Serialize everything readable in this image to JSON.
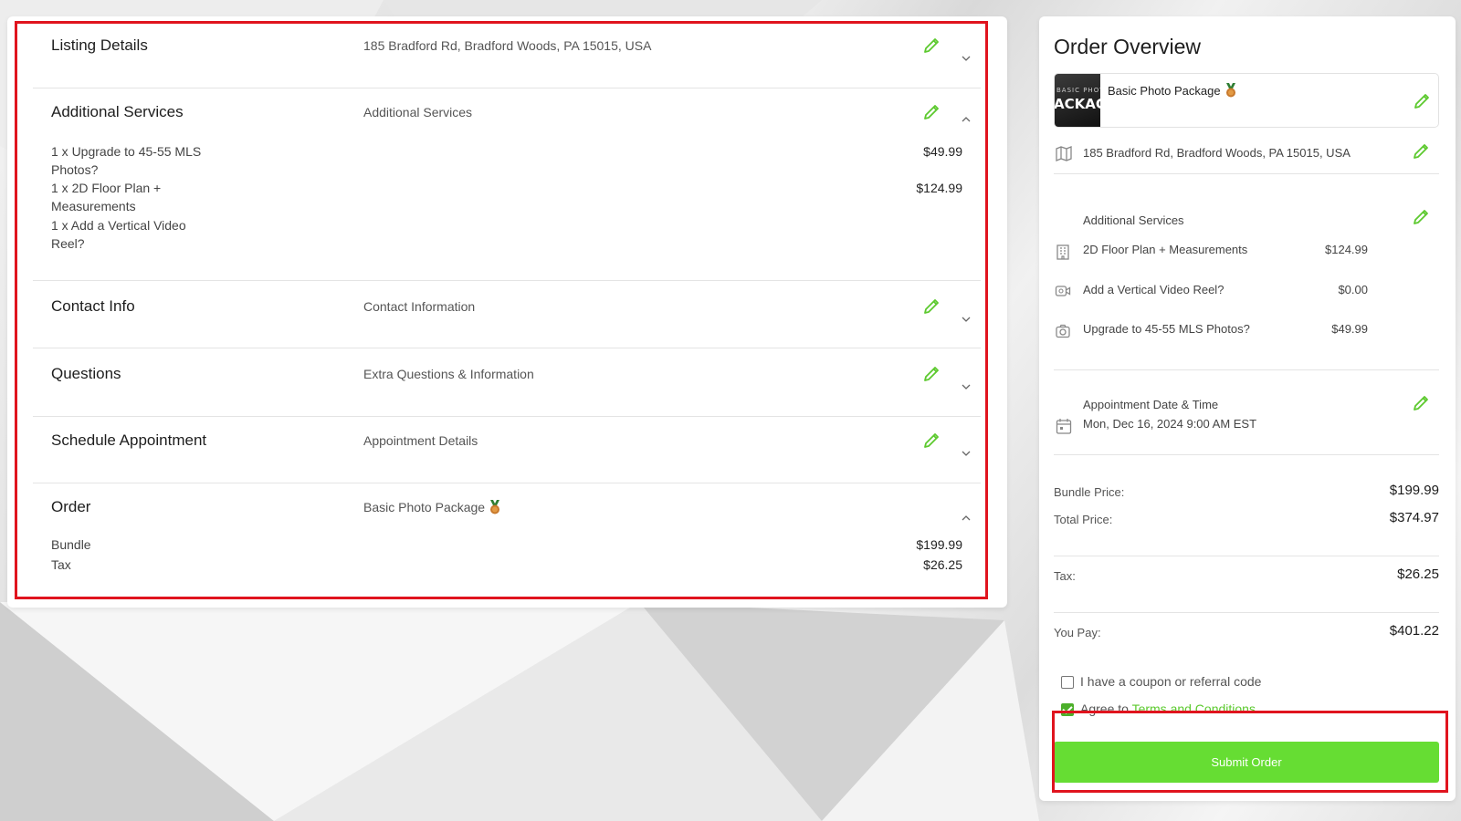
{
  "left": {
    "sections": [
      {
        "title": "Listing Details",
        "subtitle": "185 Bradford Rd, Bradford Woods, PA 15015, USA",
        "expanded": false
      },
      {
        "title": "Additional Services",
        "subtitle": "Additional Services",
        "expanded": true,
        "items": [
          {
            "label": "1 x Upgrade to 45-55 MLS Photos?",
            "price": "$49.99"
          },
          {
            "label": "1 x 2D Floor Plan + Measurements",
            "price": "$124.99"
          },
          {
            "label": "1 x Add a Vertical Video Reel?",
            "price": ""
          }
        ]
      },
      {
        "title": "Contact Info",
        "subtitle": "Contact Information",
        "expanded": false
      },
      {
        "title": "Questions",
        "subtitle": "Extra Questions & Information",
        "expanded": false
      },
      {
        "title": "Schedule Appointment",
        "subtitle": "Appointment Details",
        "expanded": false
      },
      {
        "title": "Order",
        "subtitle": "Basic Photo Package",
        "expanded": true,
        "items": [
          {
            "label": "Bundle",
            "price": "$199.99"
          },
          {
            "label": "Tax",
            "price": "$26.25"
          }
        ]
      }
    ]
  },
  "overview": {
    "title": "Order Overview",
    "package": {
      "name": "Basic Photo Package",
      "thumb_top": "BASIC PHOT",
      "thumb_main": "ACKAG"
    },
    "address": "185 Bradford Rd, Bradford Woods, PA 15015, USA",
    "services_heading": "Additional Services",
    "services": [
      {
        "icon": "building-icon",
        "label": "2D Floor Plan + Measurements",
        "price": "$124.99"
      },
      {
        "icon": "video-icon",
        "label": "Add a Vertical Video Reel?",
        "price": "$0.00"
      },
      {
        "icon": "camera-icon",
        "label": "Upgrade to 45-55 MLS Photos?",
        "price": "$49.99"
      }
    ],
    "appointment_heading": "Appointment Date & Time",
    "appointment_value": "Mon, Dec 16, 2024 9:00 AM EST",
    "bundle_label": "Bundle Price:",
    "bundle_value": "$199.99",
    "total_label": "Total Price:",
    "total_value": "$374.97",
    "tax_label": "Tax:",
    "tax_value": "$26.25",
    "pay_label": "You Pay:",
    "pay_value": "$401.22",
    "coupon_label": "I have a coupon or referral code",
    "coupon_checked": false,
    "agree_prefix": "Agree to ",
    "agree_link": "Terms and Conditions",
    "agree_checked": true,
    "submit_label": "Submit Order"
  },
  "colors": {
    "accent": "#66dd33",
    "highlight": "#e0141e",
    "pencil": "#5cc92e"
  }
}
